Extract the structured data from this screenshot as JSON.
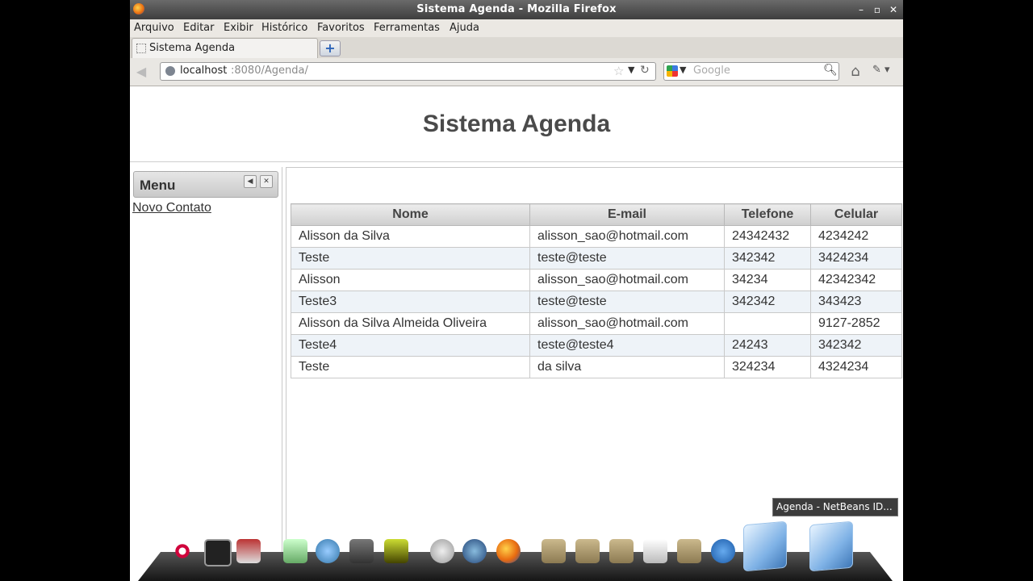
{
  "window": {
    "title": "Sistema Agenda - Mozilla Firefox",
    "controls": {
      "minimize": "–",
      "maximize": "▫",
      "close": "✕"
    }
  },
  "menubar": {
    "items": [
      "Arquivo",
      "Editar",
      "Exibir",
      "Histórico",
      "Favoritos",
      "Ferramentas",
      "Ajuda"
    ]
  },
  "tab": {
    "label": "Sistema Agenda",
    "new_tab": "+"
  },
  "navbar": {
    "url_host": "localhost",
    "url_path": ":8080/Agenda/",
    "search_placeholder": "Google"
  },
  "page": {
    "title": "Sistema Agenda",
    "menu_title": "Menu",
    "menu_link": "Novo Contato",
    "table": {
      "headers": [
        "Nome",
        "E-mail",
        "Telefone",
        "Celular"
      ],
      "rows": [
        [
          "Alisson da Silva",
          "alisson_sao@hotmail.com",
          "24342432",
          "4234242"
        ],
        [
          "Teste",
          "teste@teste",
          "342342",
          "3424234"
        ],
        [
          "Alisson",
          "alisson_sao@hotmail.com",
          "34234",
          "42342342"
        ],
        [
          "Teste3",
          "teste@teste",
          "342342",
          "343423"
        ],
        [
          "Alisson da Silva Almeida Oliveira",
          "alisson_sao@hotmail.com",
          "",
          "9127-2852"
        ],
        [
          "Teste4",
          "teste@teste4",
          "24243",
          "342342"
        ],
        [
          "Teste",
          "da silva",
          "324234",
          "4324234"
        ]
      ]
    }
  },
  "tooltip": {
    "text": "Agenda - NetBeans ID..."
  },
  "colors": {
    "accent": "#3c3c3c",
    "table_stripe": "#eef3f8",
    "title_text": "#4a4a4a"
  }
}
